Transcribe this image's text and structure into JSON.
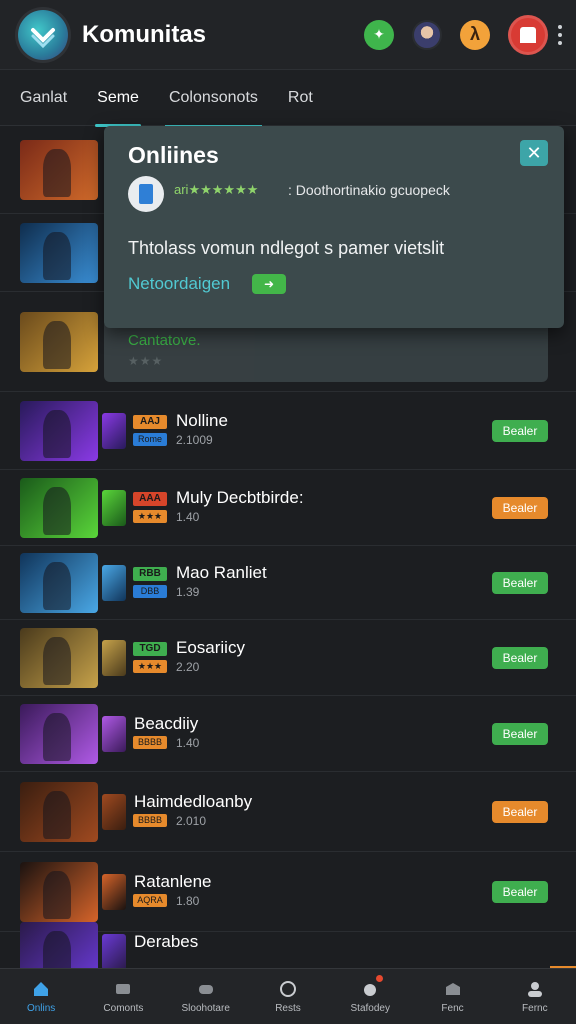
{
  "header": {
    "title": "Komunitas",
    "colors": {
      "background": "#222427",
      "accent": "#3ec7c9"
    }
  },
  "tabs": [
    {
      "label": "Ganlat"
    },
    {
      "label": "Seme"
    },
    {
      "label": "Colonsonots"
    },
    {
      "label": "Rot"
    }
  ],
  "popup": {
    "title": "Onliines",
    "rating_text": "ari★★★★★★",
    "developer": ": Doothortinakio gcuopeck",
    "description": "Thtolass vomun ndlegot s pamer vietslit",
    "link_text": "Netoordaigen",
    "close_icon": "close-icon"
  },
  "under_card": {
    "title": "Cantatove.",
    "stars": "★★★"
  },
  "games": [
    {
      "name": "",
      "tag1": "",
      "tag2": "",
      "meta": "",
      "action": "",
      "action_color": "green",
      "thumb": [
        "#7a2a18",
        "#d06a2a"
      ]
    },
    {
      "name": "",
      "tag1": "",
      "tag2": "",
      "meta": "",
      "action": "",
      "action_color": "green",
      "thumb": [
        "#0f2d4d",
        "#3a8fd6"
      ]
    },
    {
      "name": "",
      "tag1": "",
      "tag2": "",
      "meta": "",
      "action": "",
      "action_color": "green",
      "thumb": [
        "#6a4a1c",
        "#d6a23a"
      ]
    },
    {
      "name": "Nolline",
      "tag1": "AAJ",
      "tag2": "Rome",
      "meta": "2.1009",
      "action": "Bealer",
      "action_color": "green",
      "thumb": [
        "#281a5a",
        "#8a3ae6"
      ],
      "tag1_color": "#e68a2c",
      "tag2_color": "#2a7cd6"
    },
    {
      "name": "Muly Decbtbirde:",
      "tag1": "AAA",
      "tag2": "★★★",
      "meta": "1.40",
      "action": "Bealer",
      "action_color": "orange",
      "thumb": [
        "#1a5a1a",
        "#5ad63a"
      ],
      "tag1_color": "#d6452a",
      "tag2_color": "#e68a2c"
    },
    {
      "name": "Mao Ranliet",
      "tag1": "RBB",
      "tag2": "DBB",
      "meta": "1.39",
      "action": "Bealer",
      "action_color": "green",
      "thumb": [
        "#10345a",
        "#4aa8e6"
      ],
      "tag1_color": "#3fae4f",
      "tag2_color": "#2a7cd6"
    },
    {
      "name": "Eosariicy",
      "tag1": "TGD",
      "tag2": "★★★",
      "meta": "2.20",
      "action": "Bealer",
      "action_color": "green",
      "thumb": [
        "#4a3a1c",
        "#c6a24a"
      ],
      "tag1_color": "#3fae4f",
      "tag2_color": "#e68a2c"
    },
    {
      "name": "Beacdiiy",
      "tag1": "",
      "tag2": "BBBB",
      "meta": "1.40",
      "action": "Bealer",
      "action_color": "green",
      "thumb": [
        "#3a1a5a",
        "#b05ae6"
      ],
      "tag2_color": "#e68a2c"
    },
    {
      "name": "Haimdedloanby",
      "tag1": "",
      "tag2": "BBBB",
      "meta": "2.010",
      "action": "Bealer",
      "action_color": "orange",
      "thumb": [
        "#3a1e10",
        "#a04a20"
      ],
      "tag2_color": "#e68a2c"
    },
    {
      "name": "Ratanlene",
      "tag1": "",
      "tag2": "AQRA",
      "meta": "1.80",
      "action": "Bealer",
      "action_color": "green",
      "thumb": [
        "#1a1210",
        "#d6642a"
      ],
      "tag2_color": "#e68a2c"
    },
    {
      "name": "Derabes",
      "tag1": "",
      "tag2": "",
      "meta": "",
      "action": "",
      "action_color": "green",
      "thumb": [
        "#2a1a4a",
        "#6a3ad6"
      ]
    }
  ],
  "bottom_nav": [
    {
      "label": "Onlins",
      "icon": "home-icon",
      "active": true
    },
    {
      "label": "Comonts",
      "icon": "chat-icon"
    },
    {
      "label": "Sloohotare",
      "icon": "gamepad-icon"
    },
    {
      "label": "Rests",
      "icon": "circle-icon"
    },
    {
      "label": "Stafodey",
      "icon": "notification-icon",
      "badge": true
    },
    {
      "label": "Fenc",
      "icon": "store-icon"
    },
    {
      "label": "Fernc",
      "icon": "profile-icon"
    }
  ]
}
